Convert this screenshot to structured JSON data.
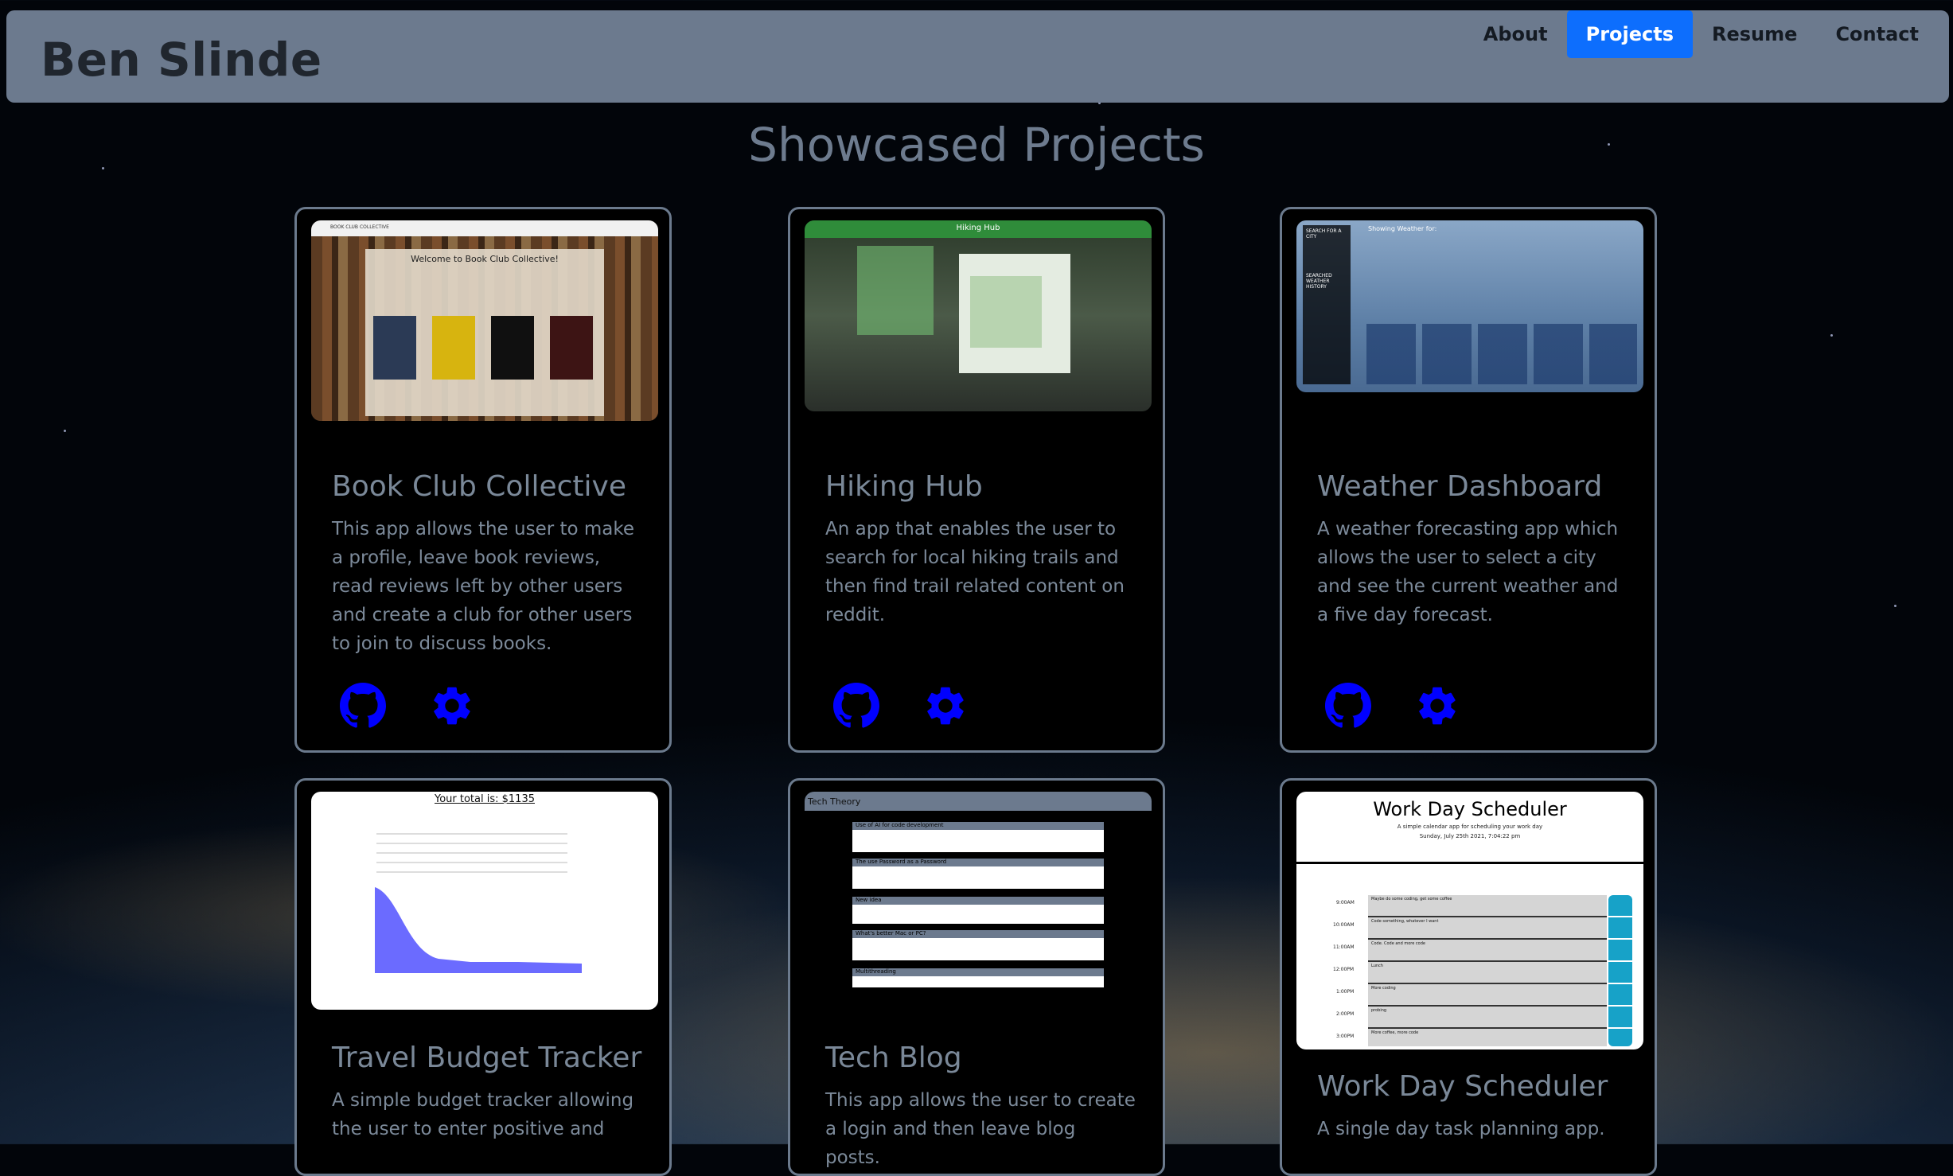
{
  "header": {
    "brand": "Ben Slinde",
    "nav": [
      "About",
      "Projects",
      "Resume",
      "Contact"
    ],
    "active": "Projects"
  },
  "main": {
    "title": "Showcased Projects"
  },
  "colors": {
    "accent": "#0d6efd",
    "icon_blue": "#0000ff",
    "navbar_bg": "#6c7a8e",
    "card_border": "#6b7a8d",
    "muted_text": "#7c8a9a"
  },
  "projects": [
    {
      "title": "Book Club Collective",
      "description": "This app allows the user to make a profile, leave book reviews, read reviews left by other users and create a club for other users to join to discuss books.",
      "shot_title": "Welcome to Book Club Collective!",
      "shot_header": "BOOK CLUB COLLECTIVE",
      "icons": [
        "github-icon",
        "gear-icon"
      ]
    },
    {
      "title": "Hiking Hub",
      "description": "An app that enables the user to search for local hiking trails and then find trail related content on reddit.",
      "shot_title": "Hiking Hub",
      "icons": [
        "github-icon",
        "gear-icon"
      ]
    },
    {
      "title": "Weather Dashboard",
      "description": "A weather forecasting app which allows the user to select a city and see the current weather and a five day forecast.",
      "shot_title": "Showing Weather for:",
      "shot_side": "SEARCH FOR A CITY",
      "shot_history": "SEARCHED WEATHER HISTORY",
      "icons": [
        "github-icon",
        "gear-icon"
      ]
    },
    {
      "title": "Travel Budget Tracker",
      "description": "A simple budget tracker allowing the user to enter positive and",
      "shot_title": "Your total is: $1135"
    },
    {
      "title": "Tech Blog",
      "description": "This app allows the user to create a login and then leave blog posts.",
      "shot_title": "Tech Theory",
      "shot_posts": [
        "Use of AI for code development",
        "The use Password as a Password",
        "New idea",
        "What's better Mac or PC?",
        "Multithreading"
      ]
    },
    {
      "title": "Work Day Scheduler",
      "description": "A single day task planning app.",
      "shot_title": "Work Day Scheduler",
      "shot_subtitle": "A simple calendar app for scheduling your work day",
      "shot_date": "Sunday, July 25th 2021, 7:04:22 pm",
      "shot_hours": [
        "9:00AM",
        "10:00AM",
        "11:00AM",
        "12:00PM",
        "1:00PM",
        "2:00PM",
        "3:00PM"
      ],
      "shot_tasks": [
        "Maybe do some coding, get some coffee",
        "Code something, whatever I want",
        "Code. Code and more code",
        "Lunch",
        "More coding",
        "probing",
        "More coffee, more code"
      ]
    }
  ]
}
